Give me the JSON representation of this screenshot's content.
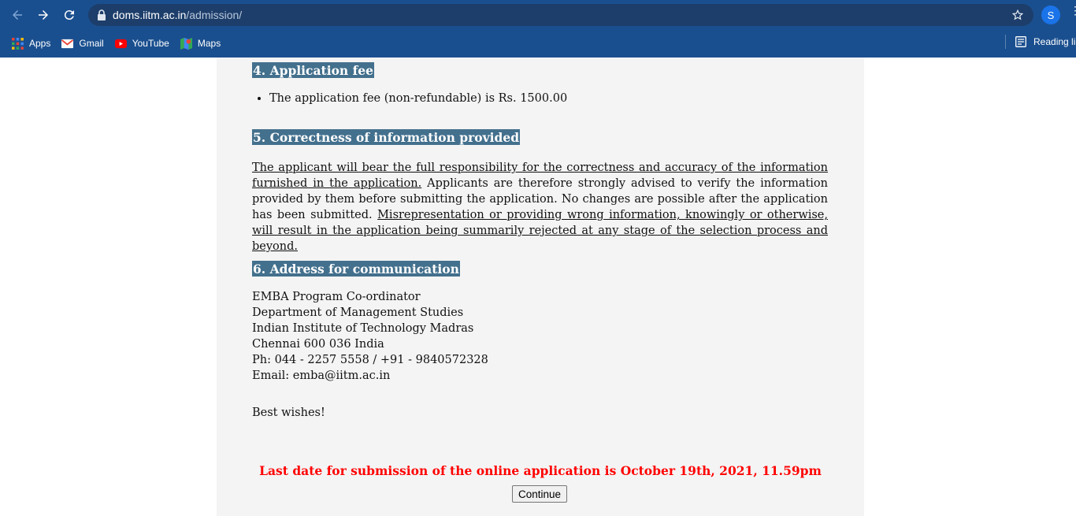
{
  "browser": {
    "url_host": "doms.iitm.ac.in",
    "url_path": "/admission/",
    "profile_initial": "S",
    "bookmarks": [
      {
        "label": "Apps",
        "icon": "apps-grid-icon"
      },
      {
        "label": "Gmail",
        "icon": "gmail-icon"
      },
      {
        "label": "YouTube",
        "icon": "youtube-icon"
      },
      {
        "label": "Maps",
        "icon": "maps-icon"
      }
    ],
    "reading_list": "Reading li"
  },
  "content": {
    "sec4_title": "4. Application fee",
    "sec4_bullet": "The application fee (non-refundable) is Rs. 1500.00",
    "sec5_title": "5. Correctness of information provided",
    "sec5_p1": "The applicant will bear the full responsibility for the correctness and accuracy of the information furnished in the application.",
    "sec5_p2": " Applicants are therefore strongly advised to verify the information provided by them before submitting the application. No changes are possible after the application has been submitted. ",
    "sec5_p3": "Misrepresentation or providing wrong information, knowingly or otherwise, will result in the application being summarily rejected at any stage of the selection process and beyond.",
    "sec6_title": "6. Address for communication",
    "address": [
      "EMBA Program Co-ordinator",
      "Department of Management Studies",
      "Indian Institute of Technology Madras",
      "Chennai 600 036 India",
      "Ph: 044 - 2257 5558 / +91 - 9840572328",
      "Email: emba@iitm.ac.in"
    ],
    "wishes": "Best wishes!",
    "deadline": "Last date for submission of the online application is October 19th, 2021, 11.59pm",
    "continue_label": "Continue"
  },
  "colors": {
    "chrome": "#1a4f8f",
    "heading_bg": "#43708d",
    "deadline": "#ff0000",
    "page_bg": "#f4f4f4"
  }
}
